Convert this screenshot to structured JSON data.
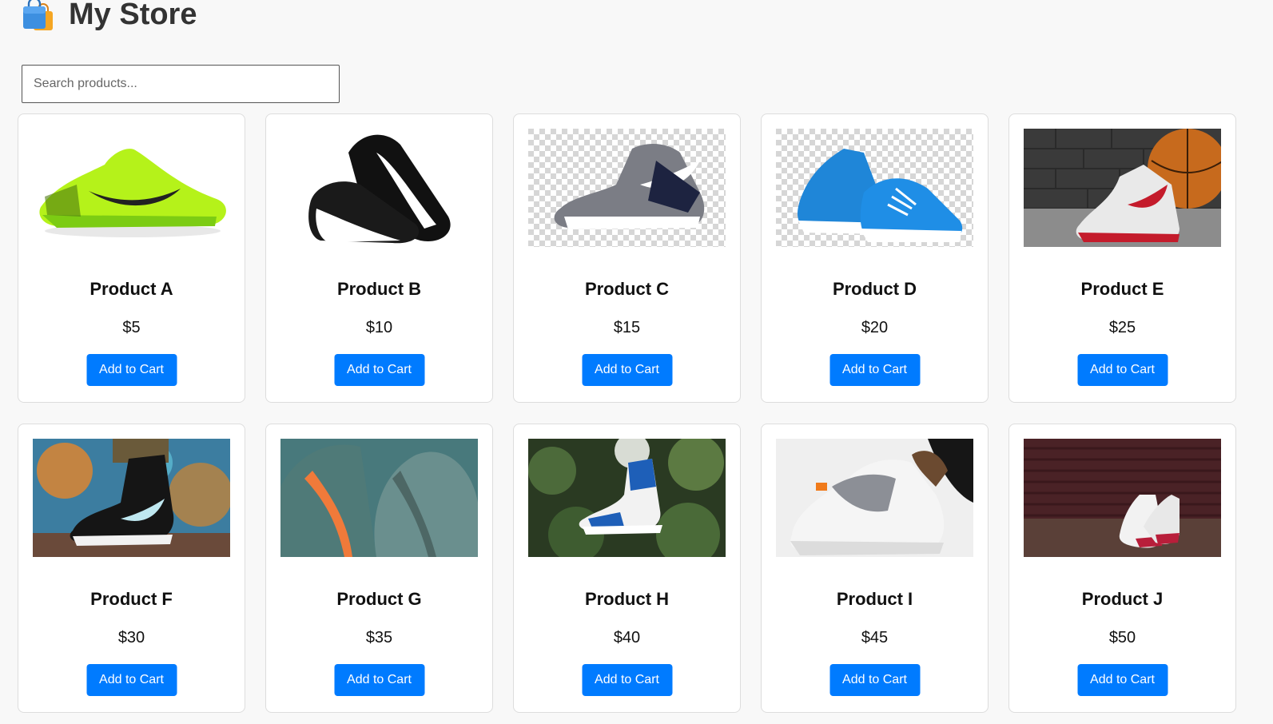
{
  "header": {
    "title": "My Store",
    "logo_icon": "shopping-bags-icon"
  },
  "search": {
    "placeholder": "Search products...",
    "value": ""
  },
  "colors": {
    "accent": "#007bff",
    "background": "#f8f8f8",
    "card": "#ffffff"
  },
  "products": [
    {
      "name": "Product A",
      "price": "$5",
      "button_label": "Add to Cart",
      "image": "neon-green-running-shoe"
    },
    {
      "name": "Product B",
      "price": "$10",
      "button_label": "Add to Cart",
      "image": "black-white-sneakers-pair"
    },
    {
      "name": "Product C",
      "price": "$15",
      "button_label": "Add to Cart",
      "image": "grey-navy-high-top-on-transparent"
    },
    {
      "name": "Product D",
      "price": "$20",
      "button_label": "Add to Cart",
      "image": "blue-canvas-sneakers-on-transparent"
    },
    {
      "name": "Product E",
      "price": "$25",
      "button_label": "Add to Cart",
      "image": "white-red-high-top-with-basketball"
    },
    {
      "name": "Product F",
      "price": "$30",
      "button_label": "Add to Cart",
      "image": "black-skate-shoe-on-ledge"
    },
    {
      "name": "Product G",
      "price": "$35",
      "button_label": "Add to Cart",
      "image": "grey-knit-sneakers-orange-stripe"
    },
    {
      "name": "Product H",
      "price": "$40",
      "button_label": "Add to Cart",
      "image": "blue-high-top-in-foliage"
    },
    {
      "name": "Product I",
      "price": "$45",
      "button_label": "Add to Cart",
      "image": "white-grey-sneaker-in-hand"
    },
    {
      "name": "Product J",
      "price": "$50",
      "button_label": "Add to Cart",
      "image": "white-red-sneakers-against-shutter"
    }
  ]
}
